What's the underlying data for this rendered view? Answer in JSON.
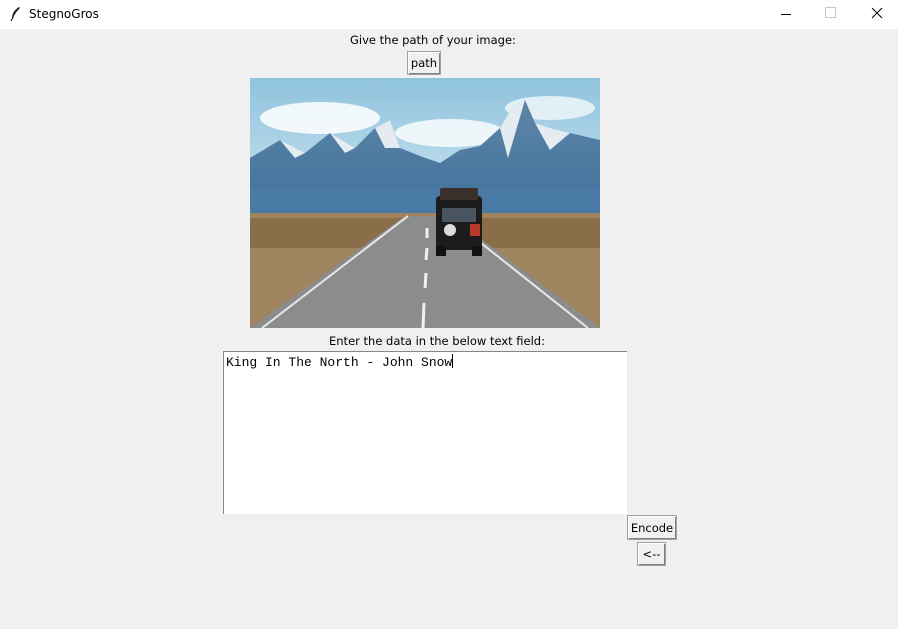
{
  "window": {
    "title": "StegnoGros",
    "icon": "feather-icon"
  },
  "labels": {
    "path_prompt": "Give the path of your image:",
    "data_prompt": "Enter the data in the below text field:"
  },
  "buttons": {
    "path": "path",
    "encode": "Encode",
    "back": "<--"
  },
  "text_field": {
    "value": "King In The North - John Snow"
  },
  "image": {
    "subject": "road-with-car-and-mountains"
  }
}
